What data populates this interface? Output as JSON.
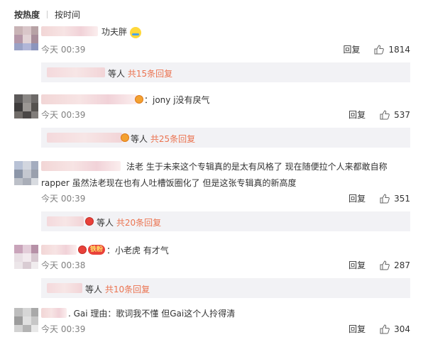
{
  "tabs": {
    "hot": "按热度",
    "time": "按时间"
  },
  "comments": [
    {
      "content": "功夫胖",
      "time": "今天 00:39",
      "reply_label": "回复",
      "likes": "1814",
      "sub": {
        "suffix": "等人",
        "link": "共15条回复"
      }
    },
    {
      "content": "：jony j没有戾气",
      "time": "今天 00:39",
      "reply_label": "回复",
      "likes": "537",
      "sub": {
        "suffix": "等人",
        "link": "共25条回复"
      }
    },
    {
      "content_line1": "法老 生于未来这个专辑真的是太有风格了 现在随便拉个人来都敢自称",
      "content_line2": "rapper 虽然法老现在也有人吐槽饭圈化了 但是这张专辑真的新高度",
      "time": "今天 00:39",
      "reply_label": "回复",
      "likes": "351",
      "sub": {
        "suffix": "等人",
        "link": "共20条回复"
      }
    },
    {
      "fan_badge": "铁粉",
      "content": "：小老虎 有才气",
      "time": "今天 00:38",
      "reply_label": "回复",
      "likes": "287",
      "sub": {
        "suffix": "等人",
        "link": "共10条回复"
      }
    },
    {
      "content": ". Gai 理由：歌词我不懂 但Gai这个人拎得清",
      "time": "今天 00:39",
      "reply_label": "回复",
      "likes": "304"
    }
  ],
  "colors": {
    "accent": "#eb7350",
    "muted": "#808080",
    "sub_bg": "#f2f2f5"
  }
}
